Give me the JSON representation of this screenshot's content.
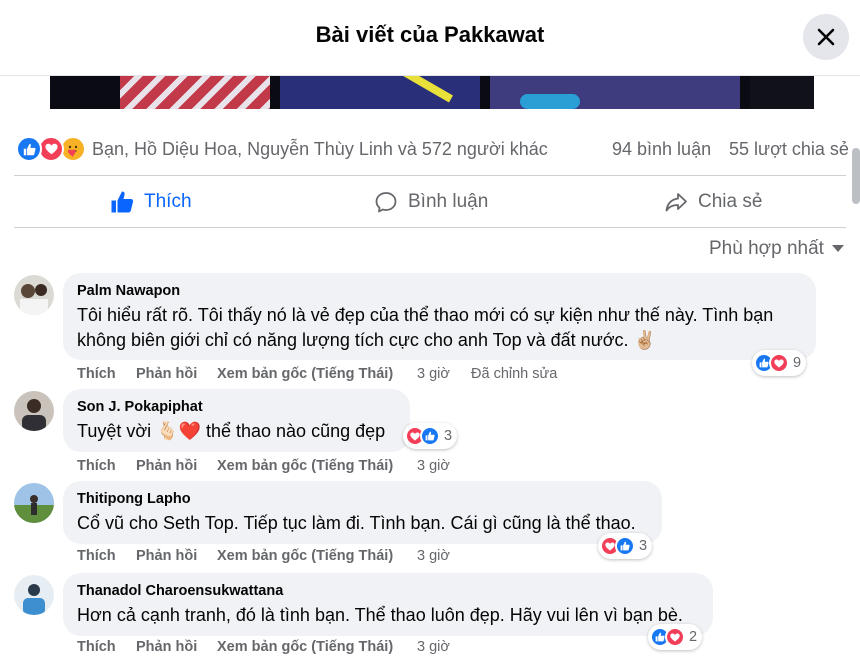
{
  "header": {
    "title": "Bài viết của Pakkawat"
  },
  "reactions": {
    "summary": "Bạn, Hồ Diệu Hoa, Nguyễn Thùy Linh và 572 người khác",
    "comments_count": "94 bình luận",
    "shares_count": "55 lượt chia sẻ"
  },
  "actions": {
    "like": "Thích",
    "comment": "Bình luận",
    "share": "Chia sẻ"
  },
  "sort": {
    "label": "Phù hợp nhất"
  },
  "comment_actions": {
    "like": "Thích",
    "reply": "Phản hồi",
    "translate": "Xem bản gốc (Tiếng Thái)"
  },
  "comments": [
    {
      "name": "Palm Nawapon",
      "lines": [
        "Tôi hiểu rất rõ. Tôi thấy nó là vẻ đẹp của thể thao mới có sự kiện như thế này. Tình bạn",
        "không biên giới chỉ có năng lượng tích cực cho anh Top và đất nước. ✌🏼"
      ],
      "time": "3 giờ",
      "edited": "Đã chỉnh sửa",
      "reaction_count": "9"
    },
    {
      "name": "Son J. Pokapiphat",
      "lines": [
        "Tuyệt vời 🫰🏻❤️ thể thao nào cũng đẹp"
      ],
      "time": "3 giờ",
      "reaction_count": "3"
    },
    {
      "name": "Thitipong Lapho",
      "lines": [
        "Cổ vũ cho Seth Top. Tiếp tục làm đi. Tình bạn. Cái gì cũng là thể thao."
      ],
      "time": "3 giờ",
      "reaction_count": "3"
    },
    {
      "name": "Thanadol Charoensukwattana",
      "lines": [
        "Hơn cả cạnh tranh, đó là tình bạn. Thể thao luôn đẹp. Hãy vui lên vì bạn bè."
      ],
      "time": "3 giờ",
      "reaction_count": "2"
    }
  ],
  "colors": {
    "accent": "#0866ff",
    "like_blue": "#1877f2",
    "love_red": "#f33e58",
    "care_yellow": "#f7b125",
    "secondary_text": "#65676b",
    "bubble_bg": "#f0f2f5"
  },
  "icons": [
    "close-icon",
    "like-reaction-icon",
    "love-reaction-icon",
    "care-reaction-icon",
    "thumbs-up-icon",
    "comment-icon",
    "share-icon",
    "caret-down-icon"
  ]
}
